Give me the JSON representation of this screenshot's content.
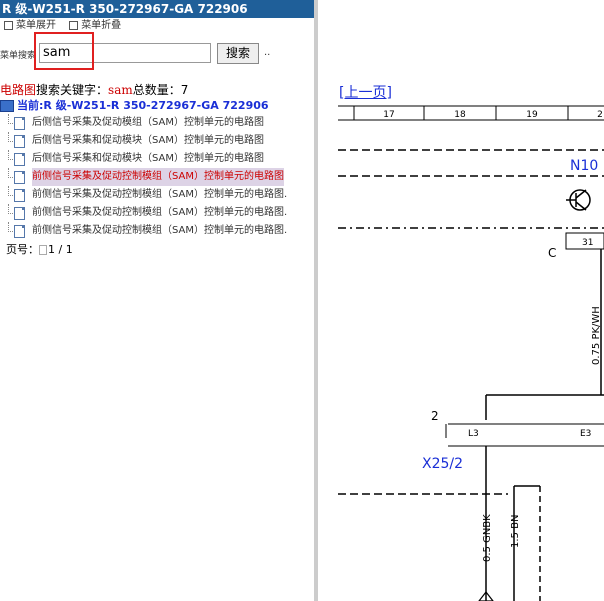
{
  "window": {
    "title": "R 级-W251-R 350-272967-GA 722906"
  },
  "options": {
    "expand": "菜单展开",
    "collapse": "菜单折叠"
  },
  "search": {
    "label": "菜单搜索",
    "value": "sam",
    "button": "搜索",
    "more": ".."
  },
  "summary": {
    "prefix": "电路图",
    "keyword_label": "搜索关键字：",
    "keyword": "sam",
    "total_label": "总数量：",
    "total": "7"
  },
  "current": {
    "label": "当前:R 级-W251-R 350-272967-GA 722906"
  },
  "tree": {
    "items": [
      {
        "label": "后侧信号采集及促动模组（SAM）控制单元的电路图"
      },
      {
        "label": "后侧信号采集和促动模块（SAM）控制单元的电路图"
      },
      {
        "label": "后侧信号采集和促动模块（SAM）控制单元的电路图"
      },
      {
        "label": "前侧信号采集及促动控制模组（SAM）控制单元的电路图"
      },
      {
        "label": "前侧信号采集及促动控制模组（SAM）控制单元的电路图."
      },
      {
        "label": "前侧信号采集及促动控制模组（SAM）控制单元的电路图."
      },
      {
        "label": "前侧信号采集及促动控制模组（SAM）控制单元的电路图."
      }
    ]
  },
  "pager": {
    "label": "页号：",
    "value": "1 / 1"
  },
  "diagram": {
    "prev": "[上一页]",
    "cols": [
      "17",
      "18",
      "19",
      "2"
    ],
    "labels": {
      "n10": "N10",
      "c": "C",
      "pin31": "31",
      "wire1": "0.75 PK/WH",
      "two": "2",
      "l3": "L3",
      "e3": "E3",
      "x25": "X25/2",
      "wire2": "0.5 GNBK",
      "wire3": "1.5 BN"
    }
  }
}
